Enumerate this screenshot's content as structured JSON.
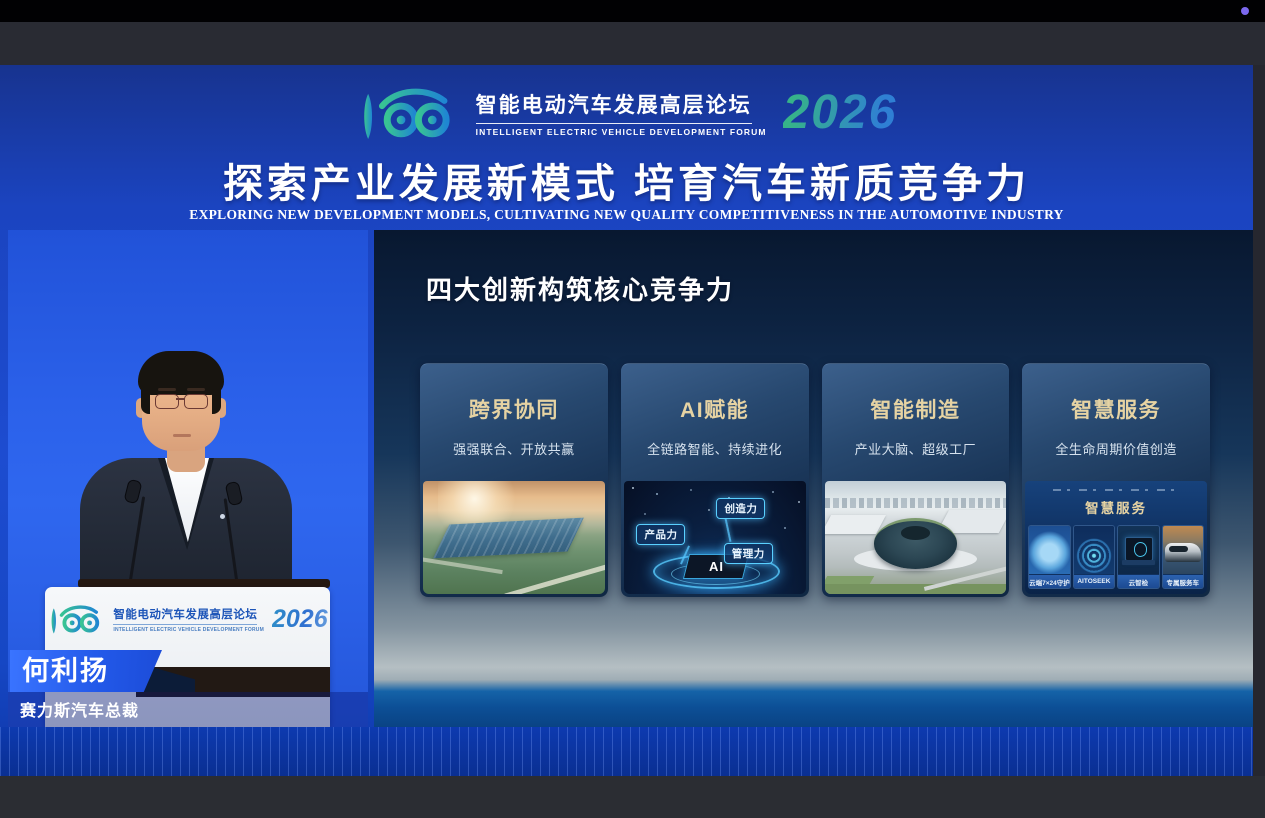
{
  "banner": {
    "logo": {
      "forum_cn": "智能电动汽车发展高层论坛",
      "forum_en": "INTELLIGENT ELECTRIC VEHICLE DEVELOPMENT FORUM",
      "year": "2026"
    },
    "title_cn": "探索产业发展新模式 培育汽车新质竞争力",
    "title_en": "EXPLORING NEW DEVELOPMENT MODELS, CULTIVATING NEW QUALITY COMPETITIVENESS IN THE AUTOMOTIVE INDUSTRY"
  },
  "speaker": {
    "name": "何利扬",
    "title": "赛力斯汽车总裁",
    "podium_logo": {
      "forum_cn": "智能电动汽车发展高层论坛",
      "forum_en": "INTELLIGENT ELECTRIC VEHICLE DEVELOPMENT FORUM",
      "year": "2026"
    }
  },
  "slide": {
    "title": "四大创新构筑核心竞争力",
    "cards": [
      {
        "title": "跨界协同",
        "subtitle": "强强联合、开放共赢",
        "image": "factory-sunset-aerial"
      },
      {
        "title": "AI赋能",
        "subtitle": "全链路智能、持续进化",
        "image": "ai-capability-platform",
        "labels": {
          "product": "产品力",
          "creation": "创造力",
          "management": "管理力",
          "core": "AI"
        }
      },
      {
        "title": "智能制造",
        "subtitle": "产业大脑、超级工厂",
        "image": "smart-factory-aerial"
      },
      {
        "title": "智慧服务",
        "subtitle": "全生命周期价值创造",
        "image": "smart-service-panel",
        "panel": {
          "title": "智慧服务",
          "items": [
            {
              "label": "云端7×24守护"
            },
            {
              "label": "AITOSEEK"
            },
            {
              "label": "云智检"
            },
            {
              "label": "专属服务车"
            }
          ]
        }
      }
    ]
  },
  "colors": {
    "stage_blue": "#1d4cd0",
    "speaker_backdrop_blue": "#2a5fe6",
    "card_title_gold": "#e6d3a3",
    "year_gradient": [
      "#36b389",
      "#2f7fd4"
    ],
    "recording_dot": "#7b68ee"
  }
}
